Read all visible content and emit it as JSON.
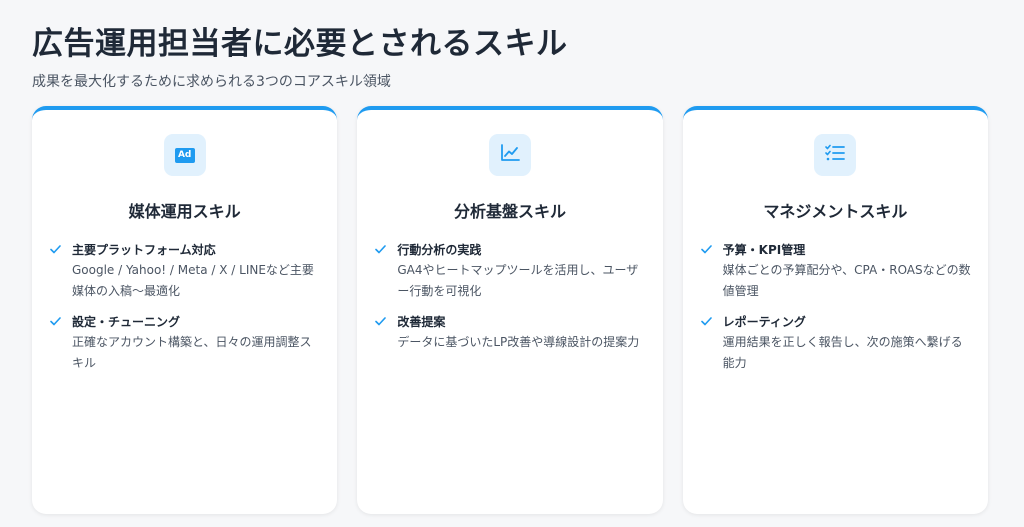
{
  "header": {
    "title": "広告運用担当者に必要とされるスキル",
    "subtitle": "成果を最大化するために求められる3つのコアスキル領域"
  },
  "colors": {
    "accent": "#1f9bf0",
    "icon_bg": "#e1f1fd",
    "text_dark": "#1f2937",
    "text_muted": "#4b5563"
  },
  "cards": [
    {
      "icon": "ad-icon",
      "icon_text": "Ad",
      "title": "媒体運用スキル",
      "items": [
        {
          "title": "主要プラットフォーム対応",
          "desc": "Google / Yahoo! / Meta / X / LINEなど主要媒体の入稿〜最適化"
        },
        {
          "title": "設定・チューニング",
          "desc": "正確なアカウント構築と、日々の運用調整スキル"
        }
      ]
    },
    {
      "icon": "line-chart-icon",
      "title": "分析基盤スキル",
      "items": [
        {
          "title": "行動分析の実践",
          "desc": "GA4やヒートマップツールを活用し、ユーザー行動を可視化"
        },
        {
          "title": "改善提案",
          "desc": "データに基づいたLP改善や導線設計の提案力"
        }
      ]
    },
    {
      "icon": "checklist-icon",
      "title": "マネジメントスキル",
      "items": [
        {
          "title": "予算・KPI管理",
          "desc": "媒体ごとの予算配分や、CPA・ROASなどの数値管理"
        },
        {
          "title": "レポーティング",
          "desc": "運用結果を正しく報告し、次の施策へ繋げる能力"
        }
      ]
    }
  ]
}
